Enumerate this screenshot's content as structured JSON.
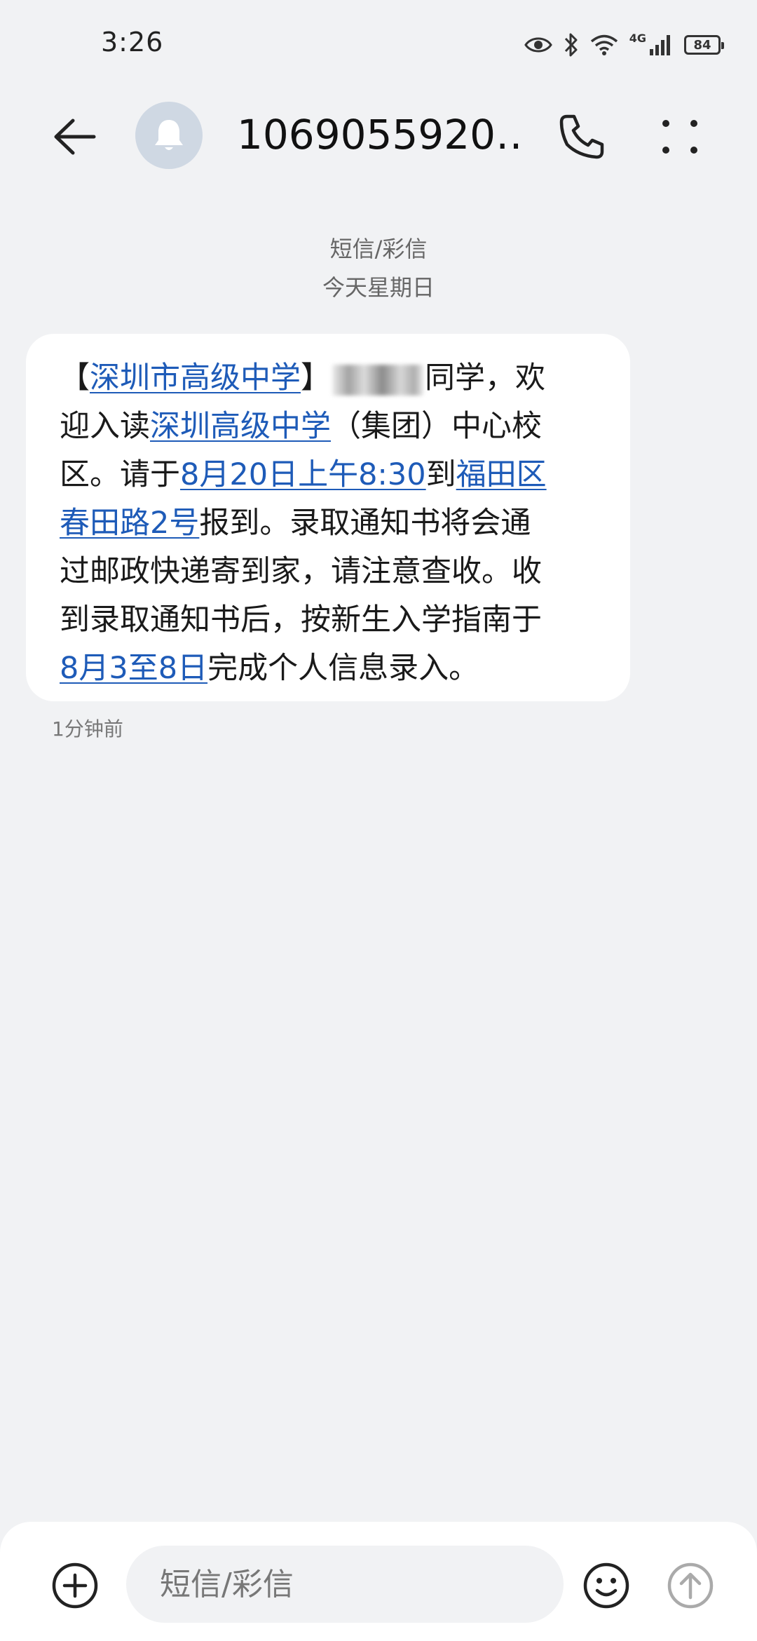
{
  "status_bar": {
    "time": "3:26",
    "battery_level": "84",
    "network": "4G",
    "icons": [
      "eye-icon",
      "bluetooth-icon",
      "wifi-icon",
      "signal-icon",
      "battery-icon"
    ]
  },
  "header": {
    "title": "1069055920…",
    "back_icon": "arrow-left-icon",
    "avatar_icon": "bell-icon",
    "call_icon": "phone-icon",
    "more_icon": "more-vertical-icon"
  },
  "conversation": {
    "message_type": "短信/彩信",
    "date_label": "今天星期日"
  },
  "message": {
    "lines": [
      [
        "【",
        "深圳市高级中学",
        "】",
        "同学，欢"
      ],
      [
        "迎入读",
        "深圳高级中学",
        "（集团）中心校"
      ],
      [
        "区。请于",
        "8月20日上午8:30",
        "到",
        "福田区"
      ],
      [
        "春田路2号",
        "报到。录取通知书将会通"
      ],
      [
        "过邮政快递寄到家，请注意查收。收"
      ],
      [
        "到录取通知书后，按新生入学指南于"
      ],
      [
        "8月3至8日",
        "完成个人信息录入。"
      ]
    ],
    "time_ago": "1分钟前"
  },
  "composer": {
    "placeholder": "短信/彩信",
    "attach_icon": "plus-circle-icon",
    "emoji_icon": "emoji-icon",
    "send_icon": "send-arrow-icon"
  },
  "colors": {
    "background": "#f1f2f4",
    "bubble": "#ffffff",
    "link": "#1e5bb8",
    "avatar_bg": "#cfd8e3"
  }
}
